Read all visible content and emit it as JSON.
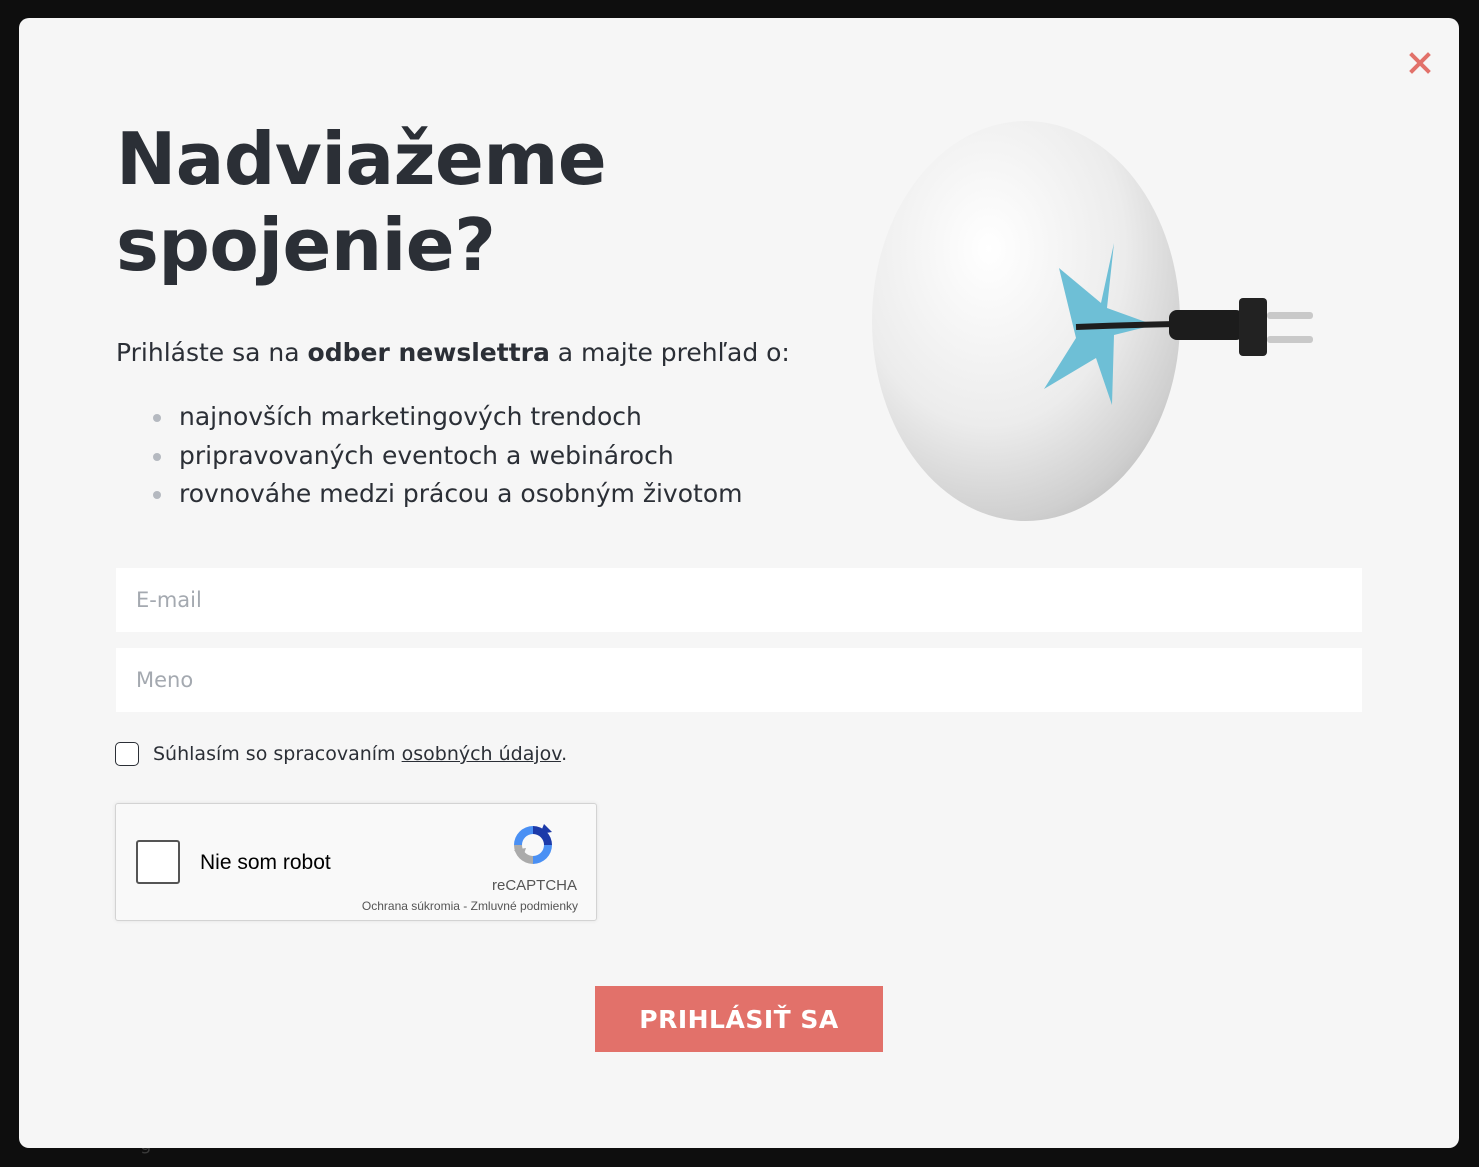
{
  "backdrop": {
    "partial_text": "g"
  },
  "modal": {
    "heading_line1": "Nadviažeme",
    "heading_line2": "spojenie?",
    "intro_prefix": "Prihláste sa na ",
    "intro_bold": "odber newslettra",
    "intro_suffix": " a majte prehľad o:",
    "benefits": [
      "najnovších marketingových trendoch",
      "pripravovaných eventoch a webinároch",
      "rovnováhe medzi prácou a osobným životom"
    ],
    "hero_image": "egg-with-power-plug",
    "close_icon": "close-icon",
    "accent_color": "#e2716a",
    "star_color": "#6ebfd6"
  },
  "form": {
    "email_placeholder": "E-mail",
    "email_value": "",
    "name_placeholder": "Meno",
    "name_value": "",
    "consent_prefix": "Súhlasím so spracovaním ",
    "consent_link": "osobných údajov",
    "consent_suffix": ".",
    "consent_checked": false,
    "submit_label": "PRIHLÁSIŤ SA"
  },
  "recaptcha": {
    "label": "Nie som robot",
    "brand": "reCAPTCHA",
    "privacy_link": "Ochrana súkromia",
    "separator": " - ",
    "terms_link": "Zmluvné podmienky",
    "checked": false
  }
}
